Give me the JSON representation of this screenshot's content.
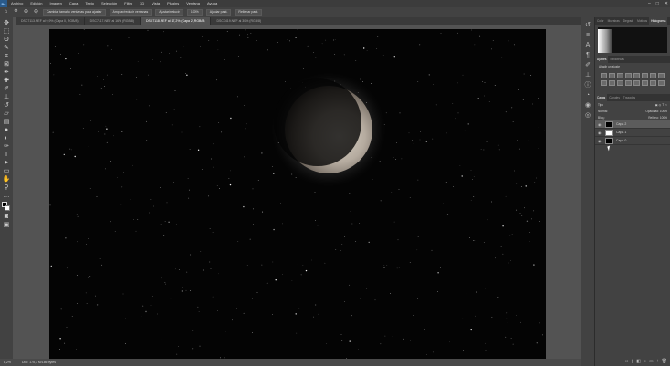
{
  "menubar": {
    "logo": "Ps",
    "items": [
      "Archivo",
      "Edición",
      "Imagen",
      "Capa",
      "Texto",
      "Selección",
      "Filtro",
      "3D",
      "Vista",
      "Plugins",
      "Ventana",
      "Ayuda"
    ],
    "window_controls": [
      "–",
      "□",
      "✕"
    ]
  },
  "options_bar": {
    "scrub_zoom_label": "Cambiar tamaño ventanas para ajustar",
    "zoom_all_label": "Ampliar/reducir ventanas",
    "scrubby_label": "Ajustar/reducir",
    "zoom_percent": "100%",
    "fit_screen_label": "Ajustar pant.",
    "fill_screen_label": "Rellenar pant."
  },
  "document_tabs": [
    "DSC7113.NEF al 9,9% (Capa 0, RGB/8)",
    "DSC7117.NEF al 16% (RGB/8)",
    "DSC7118.NEF al 17,2% (Capa 2, RGB/8)",
    "DSC7419.NEF al 30% (RGB/8)"
  ],
  "active_tab_index": 2,
  "tools": [
    "move-icon",
    "marquee-icon",
    "lasso-icon",
    "quick-select-icon",
    "crop-icon",
    "frame-icon",
    "eyedropper-icon",
    "healing-icon",
    "brush-icon",
    "stamp-icon",
    "history-brush-icon",
    "eraser-icon",
    "gradient-icon",
    "blur-icon",
    "dodge-icon",
    "pen-icon",
    "type-icon",
    "path-select-icon",
    "shape-icon",
    "hand-icon",
    "zoom-icon",
    "more-icon"
  ],
  "status": {
    "zoom": "8,2%",
    "doc_info": "Doc: 175,3 M/186 bytes"
  },
  "panels": {
    "top_tabs": [
      "Color",
      "Muestras",
      "Degrad.",
      "Motivos",
      "Histograma"
    ],
    "top_active": 4,
    "adj_tabs": [
      "Ajustes",
      "Bibliotecas"
    ],
    "adj_title": "Añadir un ajuste",
    "layer_tabs": [
      "Capas",
      "Canales",
      "Trazados"
    ],
    "kind_filter": "Tipo",
    "blend_mode": "Normal",
    "opacity_label": "Opacidad:",
    "opacity": "100%",
    "lock_label": "Bloq.:",
    "fill_label": "Relleno:",
    "fill": "100%",
    "layers": [
      {
        "name": "Capa 2",
        "thumb": "black",
        "selected": true
      },
      {
        "name": "Capa 1",
        "thumb": "white",
        "selected": false
      },
      {
        "name": "Capa 0",
        "thumb": "black",
        "selected": false
      }
    ]
  }
}
